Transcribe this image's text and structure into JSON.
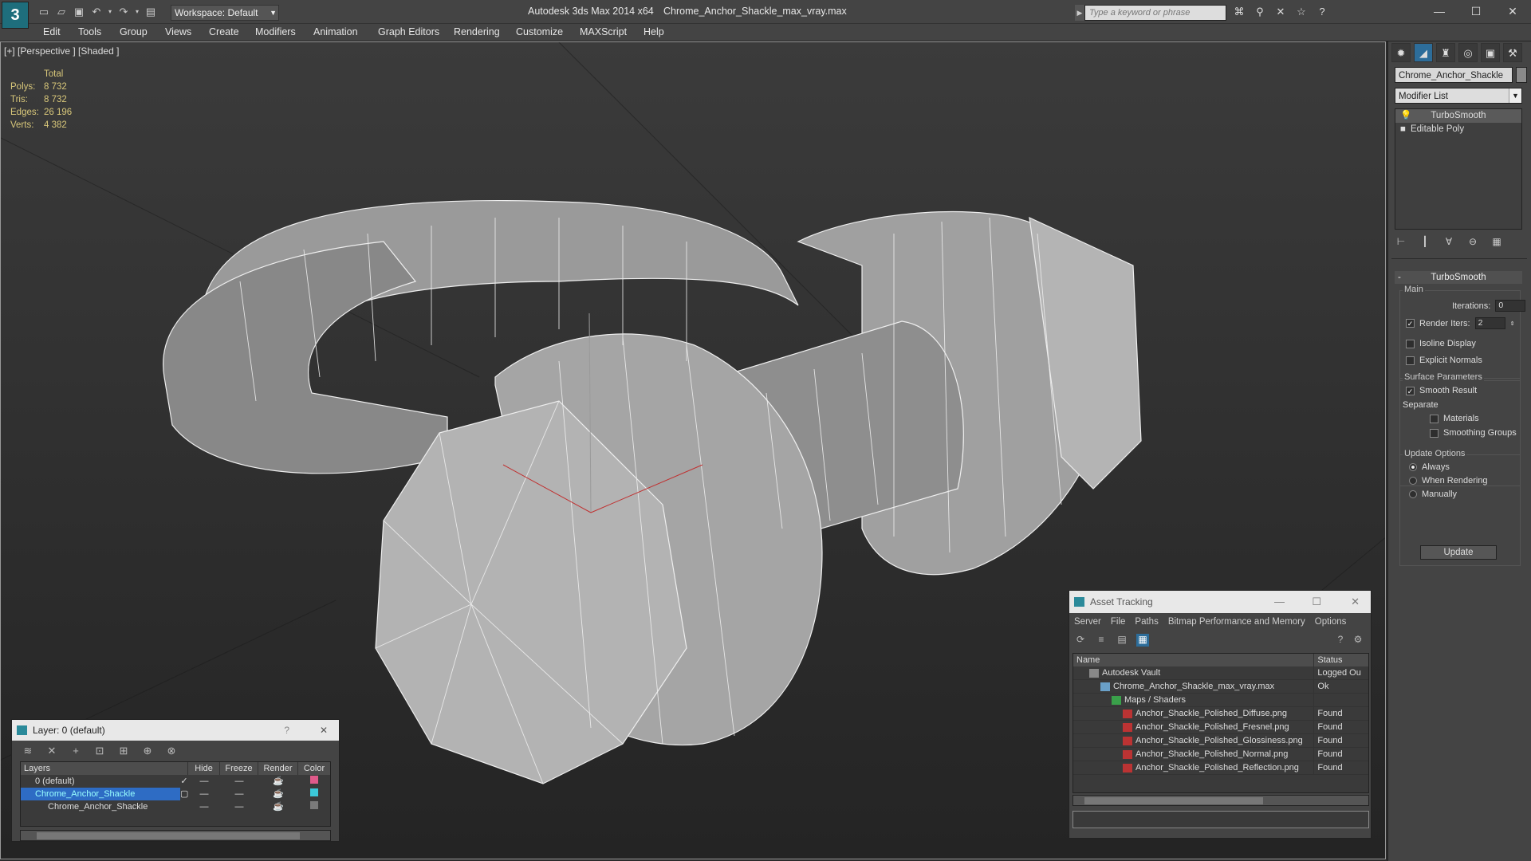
{
  "app": {
    "title": "Autodesk 3ds Max  2014 x64",
    "file": "Chrome_Anchor_Shackle_max_vray.max",
    "logo": "3",
    "workspace": "Workspace: Default",
    "search_placeholder": "Type a keyword or phrase"
  },
  "menu": [
    "Edit",
    "Tools",
    "Group",
    "Views",
    "Create",
    "Modifiers",
    "Animation",
    "Graph Editors",
    "Rendering",
    "Customize",
    "MAXScript",
    "Help"
  ],
  "viewport": {
    "label": "[+] [Perspective ] [Shaded ]",
    "stats_header": "Total",
    "stats": [
      {
        "k": "Polys:",
        "v": "8 732"
      },
      {
        "k": "Tris:",
        "v": "8 732"
      },
      {
        "k": "Edges:",
        "v": "26 196"
      },
      {
        "k": "Verts:",
        "v": "4 382"
      }
    ]
  },
  "command_panel": {
    "object_name": "Chrome_Anchor_Shackle",
    "modifier_list": "Modifier List",
    "stack": [
      "TurboSmooth",
      "Editable Poly"
    ],
    "rollout_title": "TurboSmooth",
    "main_label": "Main",
    "iterations_label": "Iterations:",
    "iterations_value": "0",
    "render_iters_label": "Render Iters:",
    "render_iters_value": "2",
    "isoline": "Isoline Display",
    "explicit": "Explicit Normals",
    "surface_label": "Surface Parameters",
    "smooth_result": "Smooth Result",
    "separate": "Separate",
    "materials": "Materials",
    "smoothing_groups": "Smoothing Groups",
    "update_label": "Update Options",
    "always": "Always",
    "when_rendering": "When Rendering",
    "manually": "Manually",
    "update_button": "Update"
  },
  "layer_panel": {
    "title": "Layer: 0 (default)",
    "help": "?",
    "close": "✕",
    "columns": [
      "Layers",
      "Hide",
      "Freeze",
      "Render",
      "Color"
    ],
    "rows": [
      {
        "name": "0 (default)",
        "color": "#e05a8a"
      },
      {
        "name": "Chrome_Anchor_Shackle",
        "color": "#3cc8d8"
      },
      {
        "name": "Chrome_Anchor_Shackle",
        "color": "#7a7a7a"
      }
    ]
  },
  "asset_panel": {
    "title": "Asset Tracking",
    "menu": [
      "Server",
      "File",
      "Paths",
      "Bitmap Performance and Memory",
      "Options"
    ],
    "col_name": "Name",
    "col_status": "Status",
    "rows": [
      {
        "name": "Autodesk Vault",
        "status": "Logged Ou",
        "indent": 1
      },
      {
        "name": "Chrome_Anchor_Shackle_max_vray.max",
        "status": "Ok",
        "indent": 2
      },
      {
        "name": "Maps / Shaders",
        "status": "",
        "indent": 3
      },
      {
        "name": "Anchor_Shackle_Polished_Diffuse.png",
        "status": "Found",
        "indent": 4
      },
      {
        "name": "Anchor_Shackle_Polished_Fresnel.png",
        "status": "Found",
        "indent": 4
      },
      {
        "name": "Anchor_Shackle_Polished_Glossiness.png",
        "status": "Found",
        "indent": 4
      },
      {
        "name": "Anchor_Shackle_Polished_Normal.png",
        "status": "Found",
        "indent": 4
      },
      {
        "name": "Anchor_Shackle_Polished_Reflection.png",
        "status": "Found",
        "indent": 4
      }
    ]
  }
}
